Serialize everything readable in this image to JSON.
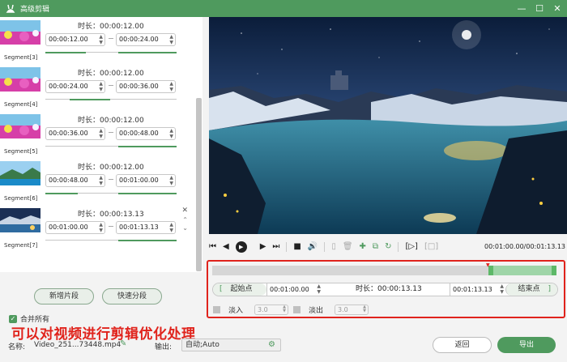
{
  "window": {
    "title": "高级剪辑",
    "logo_icon": "rabbit-logo-icon",
    "accent": "#4f9a5e"
  },
  "segments": [
    {
      "label": "Segment[3]",
      "duration_label": "时长：00:00:12.00",
      "start": "00:00:12.00",
      "end": "00:00:24.00",
      "progress": 0.3,
      "thumb": "flowers"
    },
    {
      "label": "Segment[4]",
      "duration_label": "时长：00:00:12.00",
      "start": "00:00:24.00",
      "end": "00:00:36.00",
      "progress": 0.3,
      "thumb": "flowers"
    },
    {
      "label": "Segment[5]",
      "duration_label": "时长：00:00:12.00",
      "start": "00:00:36.00",
      "end": "00:00:48.00",
      "progress": 0.3,
      "thumb": "flowers"
    },
    {
      "label": "Segment[6]",
      "duration_label": "时长：00:00:12.00",
      "start": "00:00:48.00",
      "end": "00:01:00.00",
      "progress": 0.3,
      "thumb": "lake"
    },
    {
      "label": "Segment[7]",
      "duration_label": "时长：00:00:13.13",
      "start": "00:01:00.00",
      "end": "00:01:13.13",
      "progress": 0.3,
      "thumb": "night",
      "active": true
    }
  ],
  "buttons": {
    "new_segment": "新增片段",
    "quick_split": "快速分段",
    "merge_all": "合并所有",
    "back": "返回",
    "export": "导出"
  },
  "annotation": "可以对视频进行剪辑优化处理",
  "player": {
    "timecode": "00:01:00.00/00:01:13.13",
    "icons": [
      "skip-start-icon",
      "prev-frame-icon",
      "play-icon",
      "next-frame-icon",
      "skip-end-icon",
      "stop-icon",
      "volume-icon",
      "split-icon",
      "delete-icon",
      "add-icon",
      "copy-icon",
      "reset-icon",
      "mark-in-icon",
      "mark-out-icon"
    ]
  },
  "trim": {
    "start_label": "起始点",
    "start_time": "00:01:00.00",
    "duration_label": "时长：00:00:13.13",
    "end_time": "00:01:13.13",
    "end_label": "结束点",
    "fade_in_label": "淡入",
    "fade_in_value": "3.0",
    "fade_out_label": "淡出",
    "fade_out_value": "3.0",
    "selection_start_fraction": 0.81,
    "selection_end_fraction": 1.0
  },
  "footer": {
    "name_label": "名称:",
    "file_name": "Video_251...73448.mp4",
    "output_label": "输出:",
    "output_value": "自动;Auto"
  }
}
